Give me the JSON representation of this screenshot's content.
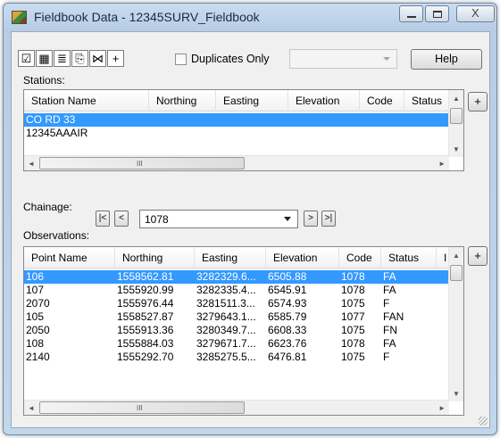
{
  "window": {
    "title": "Fieldbook Data - 12345SURV_Fieldbook",
    "close_glyph": "X"
  },
  "toolbar": {
    "icons": [
      "edit-check-icon",
      "edit-table-icon",
      "report-icon",
      "import-icon",
      "line-tool-icon",
      "point-add-icon"
    ],
    "icon_glyphs": [
      "☑",
      "▦",
      "≣",
      "⎘",
      "⋈",
      "+"
    ],
    "duplicates_label": "Duplicates Only",
    "help_label": "Help"
  },
  "stations": {
    "label": "Stations:",
    "columns": [
      "Station Name",
      "Northing",
      "Easting",
      "Elevation",
      "Code",
      "Status"
    ],
    "rows": [
      [
        "CO RD 33",
        "",
        "",
        "",
        "",
        ""
      ],
      [
        "12345AAAIR",
        "",
        "",
        "",
        "",
        ""
      ]
    ],
    "selected_index": 0
  },
  "chainage": {
    "label": "Chainage:",
    "value": "1078",
    "first": "|<",
    "prev": "<",
    "next": ">",
    "last": ">|"
  },
  "observations": {
    "label": "Observations:",
    "columns": [
      "Point Name",
      "Northing",
      "Easting",
      "Elevation",
      "Code",
      "Status",
      "I"
    ],
    "rows": [
      [
        "106",
        "1558562.81",
        "3282329.6...",
        "6505.88",
        "1078",
        "FA"
      ],
      [
        "107",
        "1555920.99",
        "3282335.4...",
        "6545.91",
        "1078",
        "FA"
      ],
      [
        "2070",
        "1555976.44",
        "3281511.3...",
        "6574.93",
        "1075",
        "F"
      ],
      [
        "105",
        "1558527.87",
        "3279643.1...",
        "6585.79",
        "1077",
        "FAN"
      ],
      [
        "2050",
        "1555913.36",
        "3280349.7...",
        "6608.33",
        "1075",
        "FN"
      ],
      [
        "108",
        "1555884.03",
        "3279671.7...",
        "6623.76",
        "1078",
        "FA"
      ],
      [
        "2140",
        "1555292.70",
        "3285275.5...",
        "6476.81",
        "1075",
        "F"
      ]
    ],
    "selected_index": 0
  },
  "side_button_glyph": "+",
  "scroll": {
    "left": "◄",
    "right": "►",
    "up": "▲",
    "down": "▼",
    "thumb_grip": "III"
  }
}
